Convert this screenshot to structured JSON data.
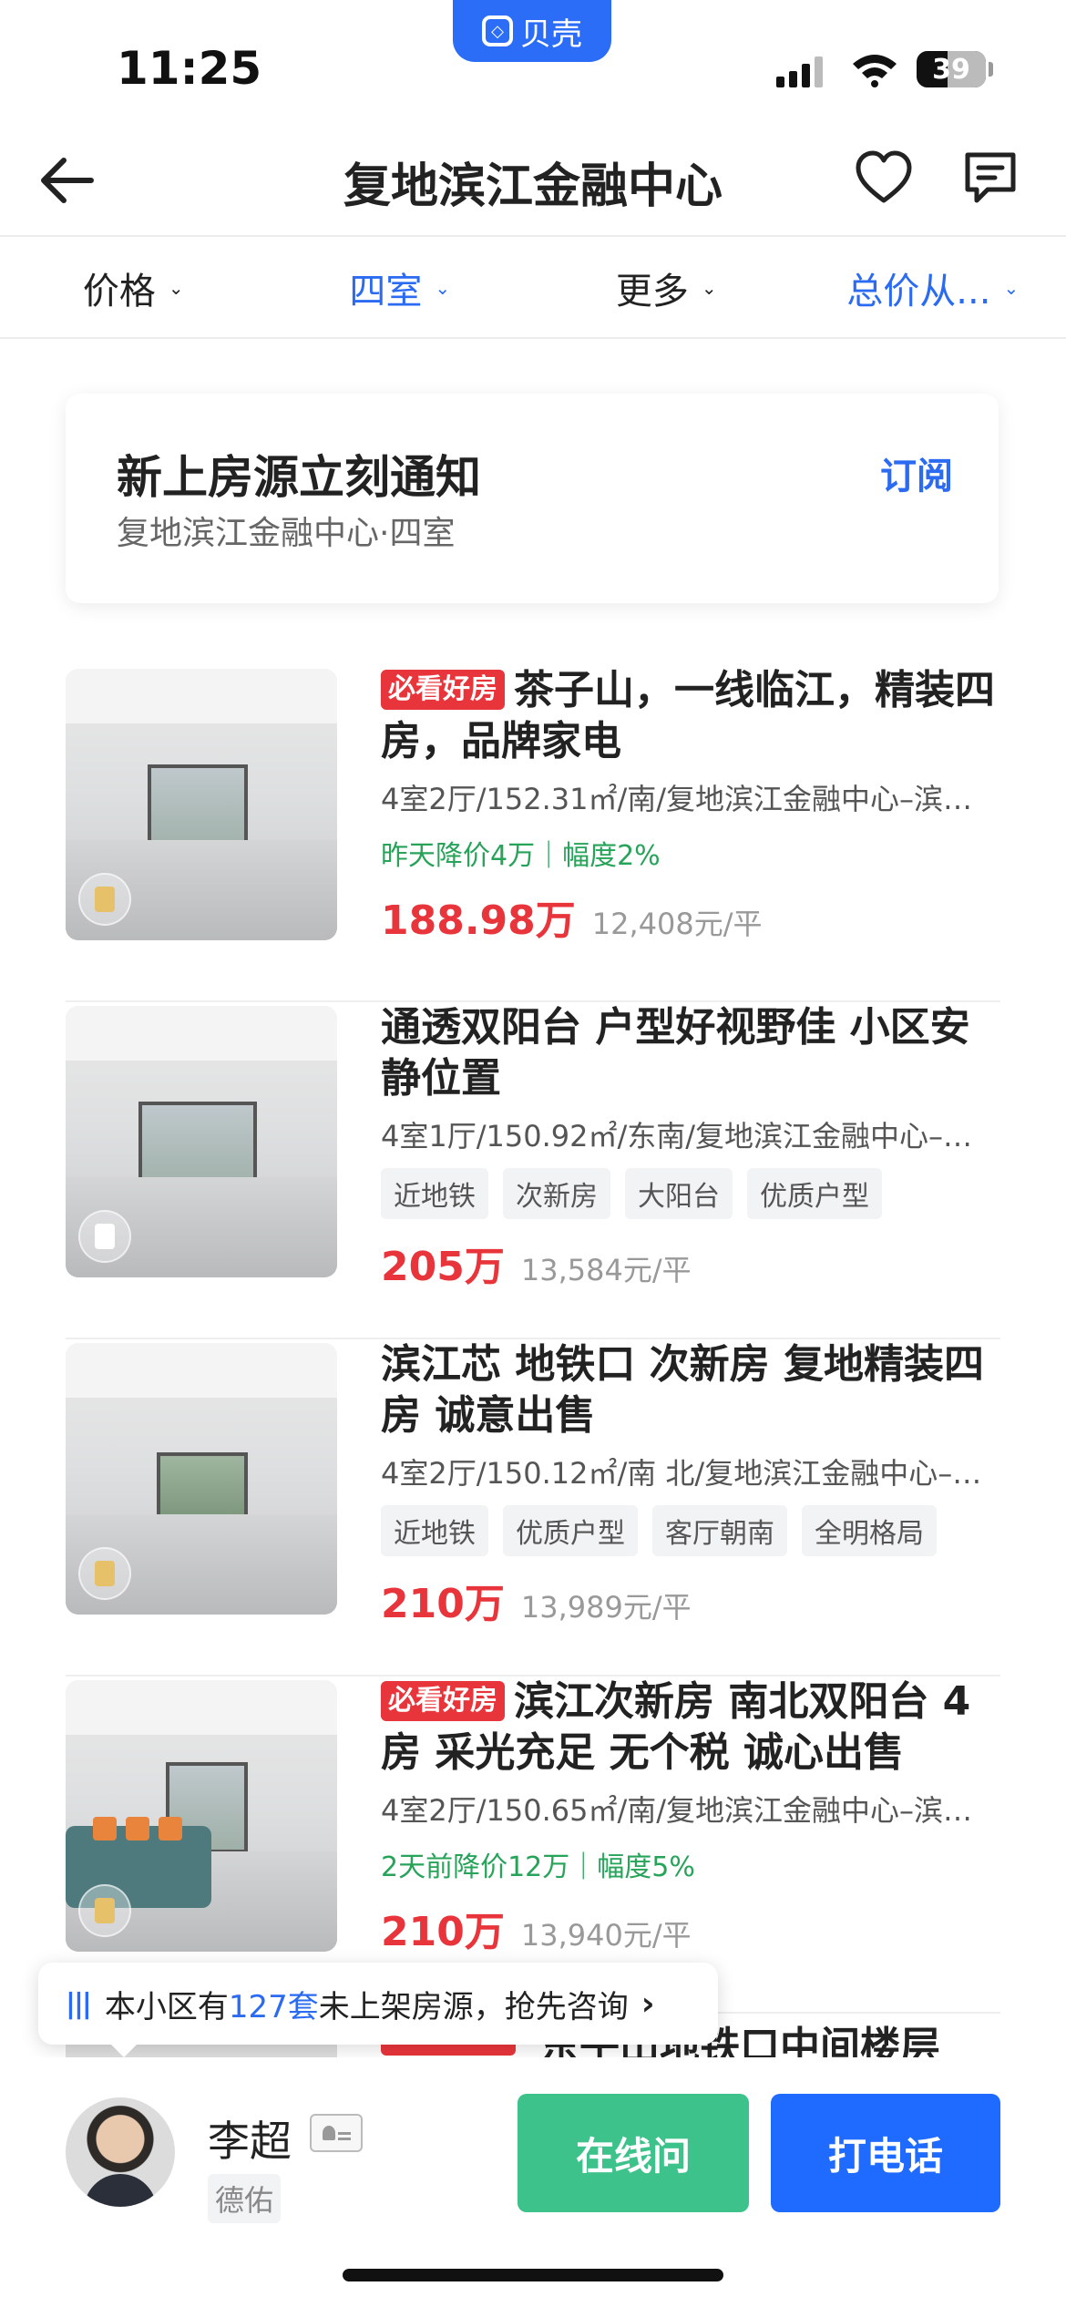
{
  "status_bar": {
    "time": "11:25",
    "app_badge": "贝壳",
    "battery": "39"
  },
  "nav": {
    "title": "复地滨江金融中心"
  },
  "filters": [
    {
      "label": "价格",
      "active": false
    },
    {
      "label": "四室",
      "active": true
    },
    {
      "label": "更多",
      "active": false
    },
    {
      "label": "总价从...",
      "active": true
    }
  ],
  "subscribe": {
    "title": "新上房源立刻通知",
    "subtitle": "复地滨江金融中心·四室",
    "button": "订阅"
  },
  "listings": [
    {
      "hot_tag": "必看好房",
      "title": "茶子山，一线临江，精装四房，品牌家电",
      "meta": "4室2厅/152.31㎡/南/复地滨江金融中心–滨…",
      "price_cut": "昨天降价4万｜幅度2%",
      "price": "188.98万",
      "unit_price": "12,408元/平"
    },
    {
      "title": "通透双阳台 户型好视野佳 小区安静位置",
      "meta": "4室1厅/150.92㎡/东南/复地滨江金融中心–…",
      "tags": [
        "近地铁",
        "次新房",
        "大阳台",
        "优质户型"
      ],
      "price": "205万",
      "unit_price": "13,584元/平"
    },
    {
      "title": "滨江芯  地铁口  次新房  复地精装四房  诚意出售",
      "meta": "4室2厅/150.12㎡/南 北/复地滨江金融中心–…",
      "tags": [
        "近地铁",
        "优质户型",
        "客厅朝南",
        "全明格局"
      ],
      "price": "210万",
      "unit_price": "13,989元/平"
    },
    {
      "hot_tag": "必看好房",
      "title": "滨江次新房 南北双阳台 4房 采光充足 无个税 诚心出售",
      "meta": "4室2厅/150.65㎡/南/复地滨江金融中心–滨…",
      "price_cut": "2天前降价12万｜幅度5%",
      "price": "210万",
      "unit_price": "13,940元/平"
    }
  ],
  "partial_listing": {
    "title": "东子山地铁口中间楼层"
  },
  "toast": {
    "prefix": "本小区有",
    "count": "127套",
    "suffix": "未上架房源，抢先咨询"
  },
  "agent": {
    "name": "李超",
    "company": "德佑"
  },
  "actions": {
    "online": "在线问",
    "call": "打电话"
  },
  "colors": {
    "accent": "#2a6bf2",
    "price": "#e8353b",
    "online": "#3cc28a",
    "call": "#1f6bff"
  }
}
